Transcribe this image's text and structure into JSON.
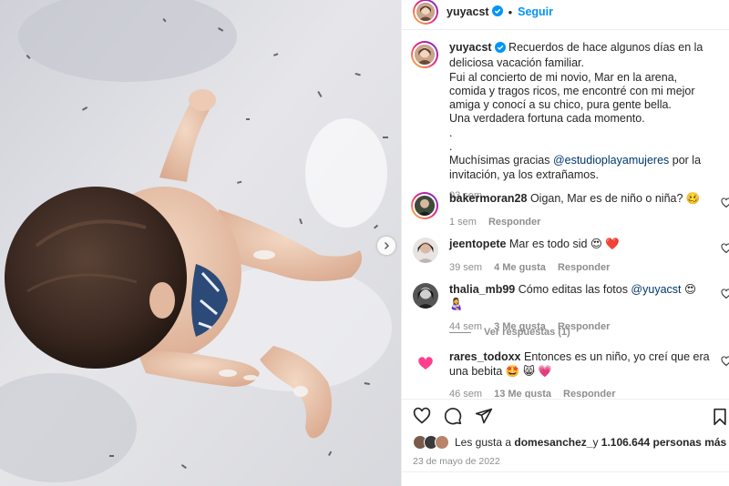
{
  "post": {
    "username": "yuyacst",
    "follow_label": "Seguir",
    "caption": {
      "text_first": "Recuerdos de hace algunos días en la deliciosa vacación familiar.",
      "text_second": "Fui al concierto de mi novio, Mar en la arena, comida y tragos ricos, me encontré con mi mejor amiga y conocí a su chico, pura gente bella.",
      "text_third": "Una verdadera fortuna cada momento.",
      "dot1": ".",
      "dot2": ".",
      "thanks_before": "Muchísimas gracias ",
      "thanks_mention": "@estudioplayamujeres",
      "thanks_after": " por la invitación, ya los extrañamos.",
      "time": "93 sem"
    },
    "comments": [
      {
        "user": "bakermoran28",
        "text": "Oigan, Mar es de niño o niña? 🥴",
        "time": "1 sem",
        "likes": "",
        "reply": "Responder"
      },
      {
        "user": "jeentopete",
        "text": "Mar es todo sid 😍 ❤️",
        "time": "39 sem",
        "likes": "4 Me gusta",
        "reply": "Responder"
      },
      {
        "user": "thalia_mb99",
        "text_before": "Cómo editas las fotos ",
        "mention": "@yuyacst",
        "text_after": " 😍 👩‍🍼",
        "time": "44 sem",
        "likes": "3 Me gusta",
        "reply": "Responder"
      },
      {
        "user": "rares_todoxx",
        "text": "Entonces es un niño, yo creí que era una bebita 🤩 😸 💗",
        "time": "46 sem",
        "likes": "13 Me gusta",
        "reply": "Responder"
      }
    ],
    "view_replies": "Ver respuestas (1)",
    "likes": {
      "prefix": "Les gusta a ",
      "user": "domesanchez_",
      "middle": " y ",
      "count": "1.106.644 personas más"
    },
    "date": "23 de mayo de 2022"
  },
  "colors": {
    "accent": "#0095f6",
    "verified": "#0095f6",
    "heart": "#ed4956",
    "muted": "#8e8e8e",
    "link": "#00376b"
  },
  "icons": [
    "heart-icon",
    "comment-icon",
    "share-icon",
    "bookmark-icon",
    "chevron-right-icon",
    "verified-badge-icon"
  ]
}
